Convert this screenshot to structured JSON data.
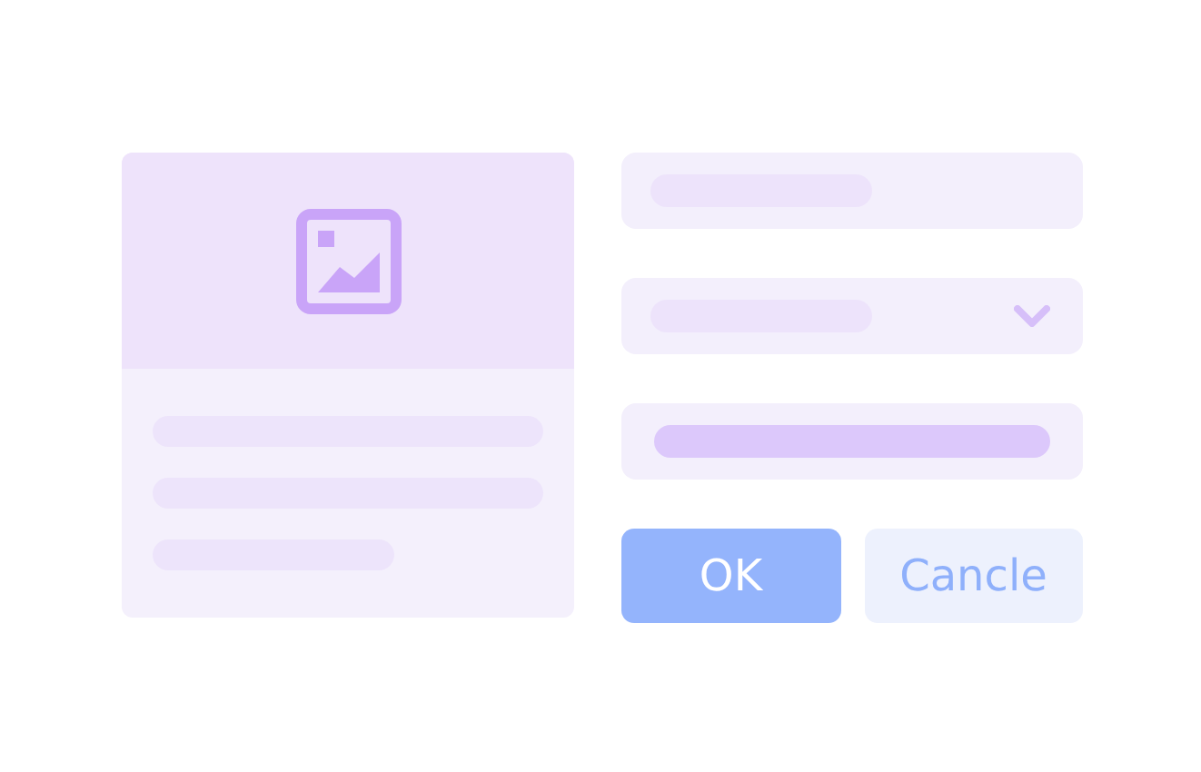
{
  "fields": [
    {
      "kind": "text"
    },
    {
      "kind": "select"
    },
    {
      "kind": "filled"
    }
  ],
  "buttons": [
    {
      "label": "OK",
      "kind": "primary"
    },
    {
      "label": "Cancle",
      "kind": "secondary"
    }
  ]
}
